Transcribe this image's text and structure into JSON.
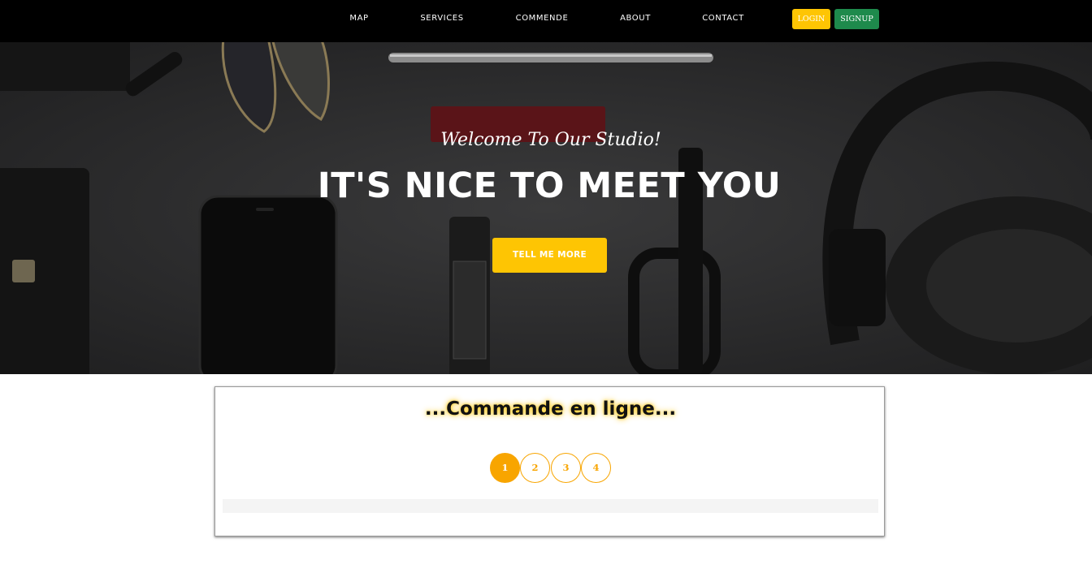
{
  "colors": {
    "accent": "#fec503",
    "signup": "#1e8a4c",
    "step_accent": "#f8a500",
    "navbar_bg": "#000000"
  },
  "navbar": {
    "links": [
      "MAP",
      "SERVICES",
      "COMMENDE",
      "ABOUT",
      "CONTACT"
    ],
    "login_label": "LOGIN",
    "signup_label": "SIGNUP"
  },
  "hero": {
    "subtitle": "Welcome To Our Studio!",
    "title": "IT'S NICE TO MEET YOU",
    "button_label": "TELL ME MORE"
  },
  "order": {
    "heading": "...Commande en ligne...",
    "steps": [
      "1",
      "2",
      "3",
      "4"
    ],
    "active_step": 1,
    "progress_fraction": 0
  }
}
